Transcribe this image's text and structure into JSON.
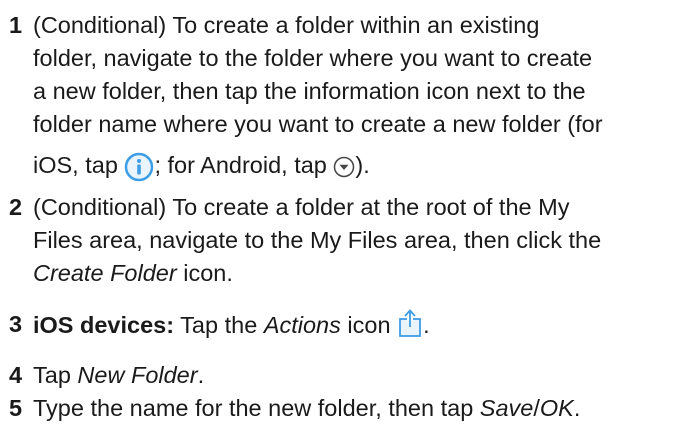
{
  "steps": [
    {
      "number": "1",
      "lines": [
        "(Conditional) To create a folder within an existing",
        "folder, navigate to the folder where you want to create",
        "a new folder, then tap the information icon next to the",
        "folder name where you want to create a new folder (for"
      ],
      "last_line": {
        "part1": "iOS, tap ",
        "icon1": "info-circle-icon",
        "part2": "; for Android, tap ",
        "icon2": "chevron-down-circle-icon",
        "part3": ")."
      }
    },
    {
      "number": "2",
      "line1": "(Conditional) To create a folder at the root of the My",
      "line2": "Files area, navigate to the My Files area, then click the",
      "em": "Create Folder",
      "after_em": " icon."
    },
    {
      "number": "3",
      "bold": "iOS devices:",
      "before_em": " Tap the ",
      "em": "Actions",
      "after_em": " icon ",
      "icon": "share-upload-icon",
      "end": "."
    },
    {
      "number": "4",
      "before_em": "Tap ",
      "em": "New Folder",
      "end": "."
    },
    {
      "number": "5",
      "before_em": "Type the name for the new folder, then tap ",
      "em1": "Save",
      "sep": "/",
      "em2": "OK",
      "end": "."
    }
  ],
  "colors": {
    "text": "#1a1a1a",
    "ios_icon": "#3d9ee6",
    "android_icon_stroke": "#444444"
  }
}
